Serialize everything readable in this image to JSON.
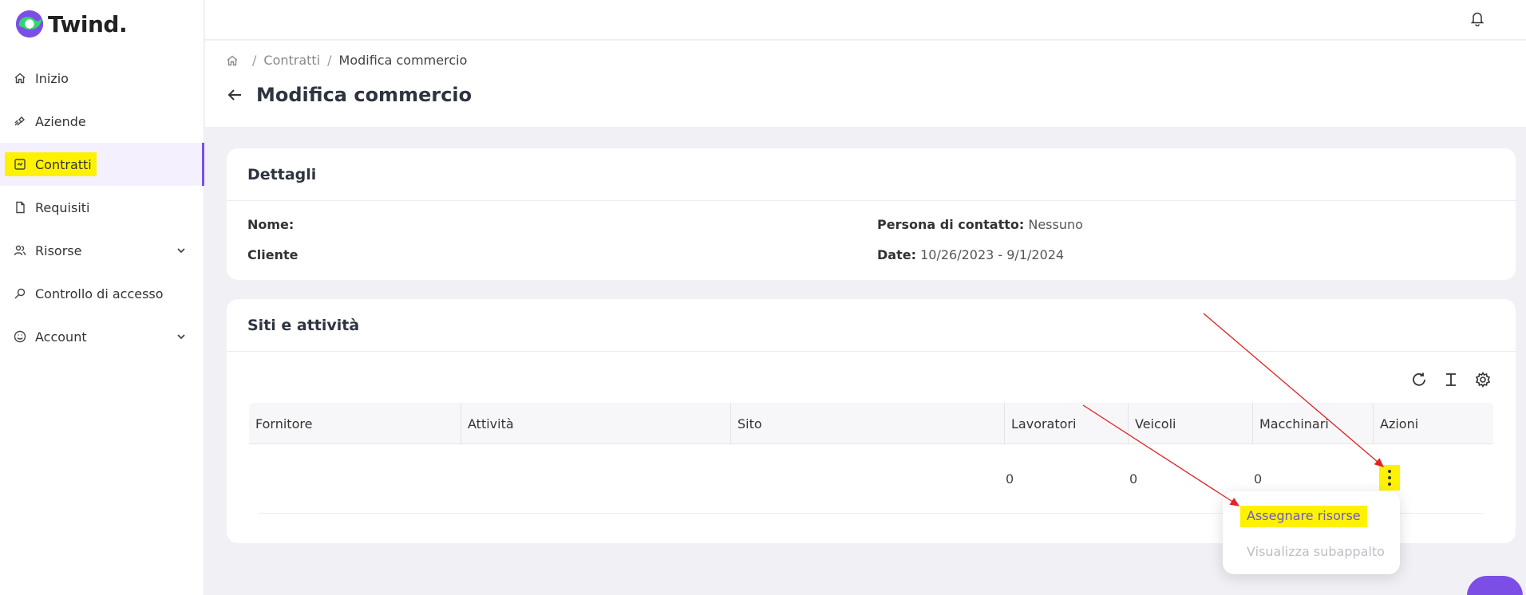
{
  "app": {
    "name": "Twind."
  },
  "sidebar": {
    "items": [
      {
        "label": "Inizio",
        "icon": "home-icon"
      },
      {
        "label": "Aziende",
        "icon": "handshake-icon"
      },
      {
        "label": "Contratti",
        "icon": "contract-icon"
      },
      {
        "label": "Requisiti",
        "icon": "document-icon"
      },
      {
        "label": "Risorse",
        "icon": "people-icon"
      },
      {
        "label": "Controllo di accesso",
        "icon": "key-icon"
      },
      {
        "label": "Account",
        "icon": "account-icon"
      }
    ]
  },
  "breadcrumb": {
    "parent": "Contratti",
    "current": "Modifica commercio"
  },
  "page": {
    "title": "Modifica commercio"
  },
  "details": {
    "title": "Dettagli",
    "name_label": "Nome:",
    "client_label": "Cliente",
    "contact_label": "Persona di contatto:",
    "contact_value": "Nessuno",
    "date_label": "Date:",
    "date_value": "10/26/2023 - 9/1/2024"
  },
  "sites": {
    "title": "Siti e attività",
    "columns": [
      "Fornitore",
      "Attività",
      "Sito",
      "Lavoratori",
      "Veicoli",
      "Macchinari",
      "Azioni"
    ],
    "row": {
      "lavoratori": "0",
      "veicoli": "0",
      "macchinari": "0"
    }
  },
  "menu": {
    "items": [
      "Assegnare risorse",
      "Visualizza subappalto"
    ]
  },
  "colors": {
    "accent": "#7b4fe6",
    "highlight": "#fff200",
    "annotation": "#e02424"
  }
}
